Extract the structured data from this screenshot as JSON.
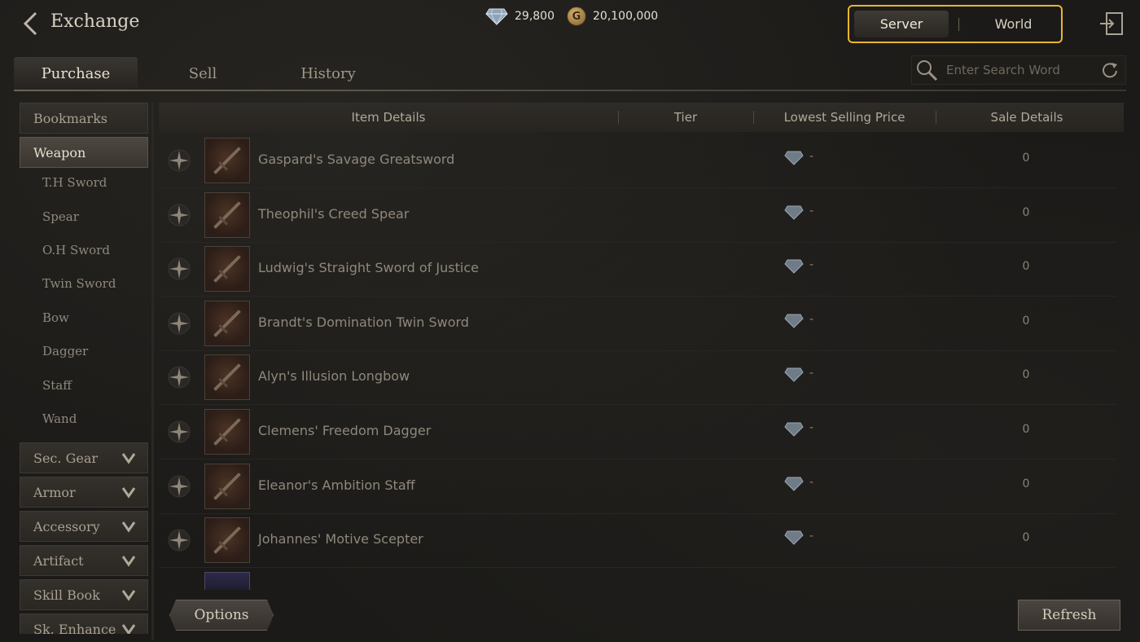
{
  "header": {
    "title": "Exchange",
    "diamond_count": "29,800",
    "gold_icon": "G",
    "gold_count": "20,100,000",
    "scope_options": [
      "Server",
      "World"
    ],
    "scope_selected": "Server"
  },
  "tabs": [
    "Purchase",
    "Sell",
    "History"
  ],
  "active_tab": "Purchase",
  "search": {
    "placeholder": "Enter Search Word"
  },
  "sidebar": {
    "bookmarks": "Bookmarks",
    "selected_category": "Weapon",
    "weapon_subcategories": [
      "T.H Sword",
      "Spear",
      "O.H Sword",
      "Twin Sword",
      "Bow",
      "Dagger",
      "Staff",
      "Wand"
    ],
    "collapsed_categories": [
      "Sec. Gear",
      "Armor",
      "Accessory",
      "Artifact",
      "Skill Book",
      "Sk. Enhance"
    ]
  },
  "table": {
    "columns": [
      "Item Details",
      "Tier",
      "Lowest Selling Price",
      "Sale Details"
    ],
    "rows": [
      {
        "name": "Gaspard's Savage Greatsword",
        "tier": "",
        "price": "-",
        "sale": "0"
      },
      {
        "name": "Theophil's Creed Spear",
        "tier": "",
        "price": "-",
        "sale": "0"
      },
      {
        "name": "Ludwig's Straight Sword of Justice",
        "tier": "",
        "price": "-",
        "sale": "0"
      },
      {
        "name": "Brandt's Domination Twin Sword",
        "tier": "",
        "price": "-",
        "sale": "0"
      },
      {
        "name": "Alyn's Illusion Longbow",
        "tier": "",
        "price": "-",
        "sale": "0"
      },
      {
        "name": "Clemens' Freedom Dagger",
        "tier": "",
        "price": "-",
        "sale": "0"
      },
      {
        "name": "Eleanor's Ambition Staff",
        "tier": "",
        "price": "-",
        "sale": "0"
      },
      {
        "name": "Johannes' Motive Scepter",
        "tier": "",
        "price": "-",
        "sale": "0"
      }
    ]
  },
  "footer": {
    "options_label": "Options",
    "refresh_label": "Refresh"
  },
  "colors": {
    "highlight": "#e8b62f",
    "background": "#1b1a18",
    "text": "#cfc7b6"
  }
}
